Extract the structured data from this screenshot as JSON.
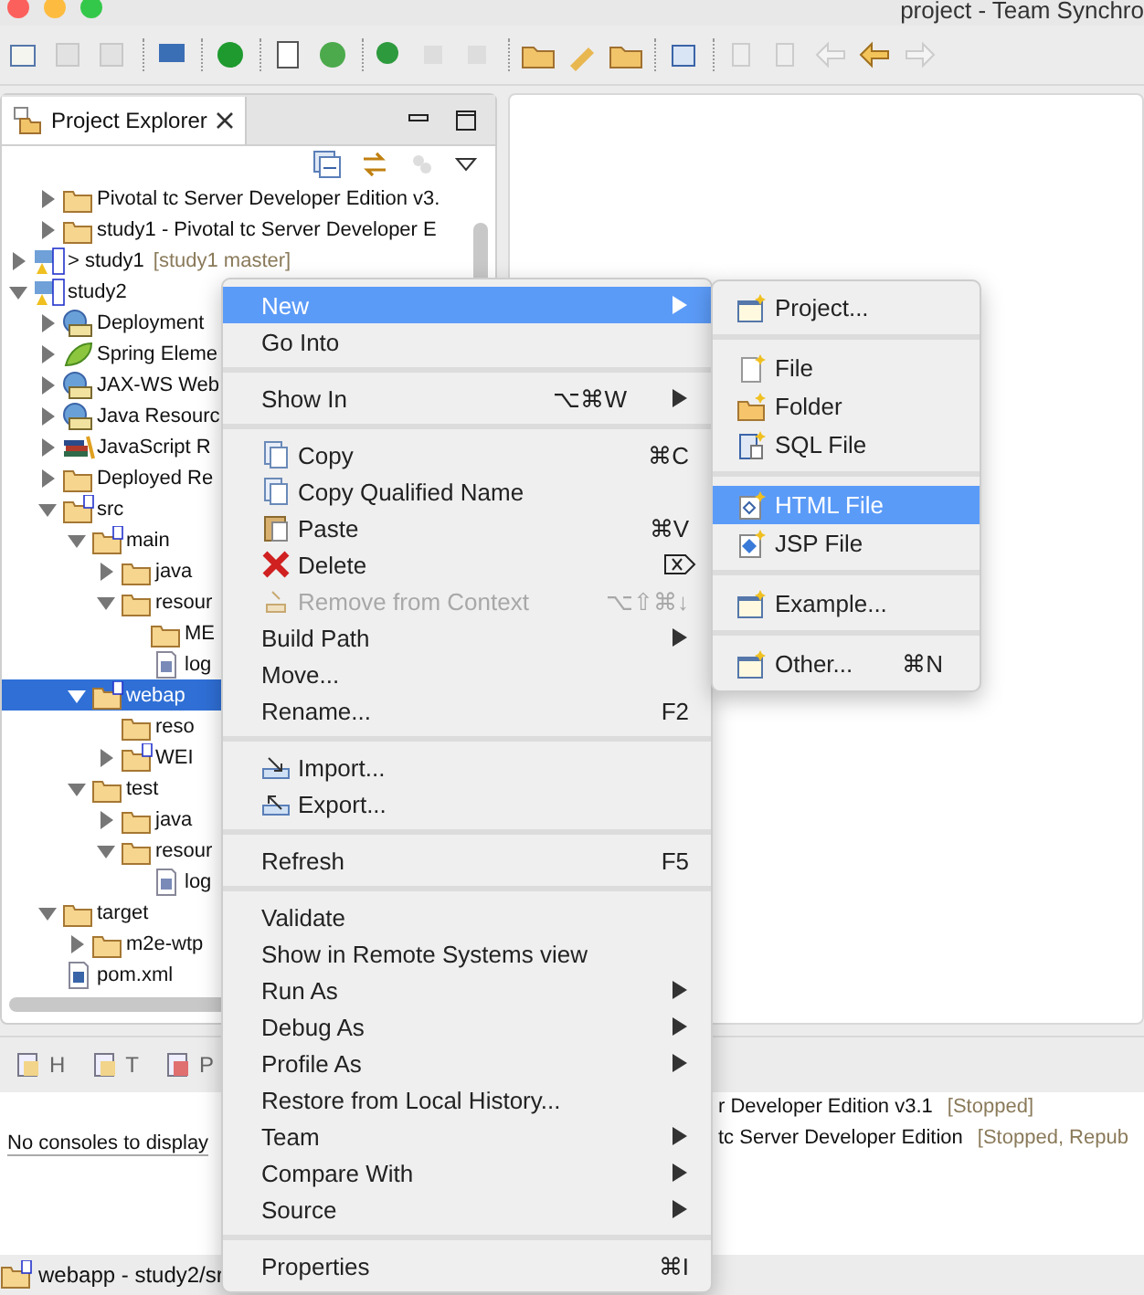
{
  "window": {
    "title": "project - Team Synchro"
  },
  "project_explorer": {
    "tab": {
      "label": "Project Explorer",
      "selected": true
    },
    "tree": [
      {
        "children": [
          {
            "label": "Pivotal tc Server Developer Edition v3.",
            "kind": "folder",
            "expanded": false,
            "selected": false
          },
          {
            "label": "study1 - Pivotal tc Server Developer E",
            "kind": "folder",
            "expanded": false,
            "selected": false
          }
        ]
      },
      {
        "label": "> study1",
        "decoration": "[study1 master]",
        "kind": "project",
        "expanded": false,
        "selected": false
      },
      {
        "label": "study2",
        "kind": "project",
        "expanded": true,
        "selected": false,
        "children": [
          {
            "label": "Deployment",
            "kind": "node",
            "expanded": false,
            "selected": false
          },
          {
            "label": "Spring Eleme",
            "kind": "leaf",
            "expanded": false,
            "selected": false
          },
          {
            "label": "JAX-WS Web",
            "kind": "node",
            "expanded": false,
            "selected": false
          },
          {
            "label": "Java Resourc",
            "kind": "node",
            "expanded": false,
            "selected": false
          },
          {
            "label": "JavaScript R",
            "kind": "books",
            "expanded": false,
            "selected": false
          },
          {
            "label": "Deployed Re",
            "kind": "folder",
            "expanded": false,
            "selected": false
          },
          {
            "label": "src",
            "kind": "source",
            "expanded": true,
            "selected": false,
            "children": [
              {
                "label": "main",
                "kind": "source",
                "expanded": true,
                "selected": false,
                "children": [
                  {
                    "label": "java",
                    "kind": "folder",
                    "expanded": false,
                    "selected": false
                  },
                  {
                    "label": "resour",
                    "kind": "folder",
                    "expanded": true,
                    "selected": false,
                    "children": [
                      {
                        "label": "ME",
                        "kind": "folder",
                        "selected": false
                      },
                      {
                        "label": "log",
                        "kind": "xml",
                        "selected": false
                      }
                    ]
                  }
                ]
              },
              {
                "label": "webap",
                "kind": "source",
                "expanded": true,
                "selected": true,
                "children": [
                  {
                    "label": "reso",
                    "kind": "folder",
                    "selected": false
                  },
                  {
                    "label": "WEI",
                    "kind": "source",
                    "expanded": false,
                    "selected": false
                  }
                ]
              },
              {
                "label": "test",
                "kind": "folder",
                "expanded": true,
                "selected": false,
                "children": [
                  {
                    "label": "java",
                    "kind": "folder",
                    "expanded": false,
                    "selected": false
                  },
                  {
                    "label": "resour",
                    "kind": "folder",
                    "expanded": true,
                    "selected": false,
                    "children": [
                      {
                        "label": "log",
                        "kind": "xml",
                        "selected": false
                      }
                    ]
                  }
                ]
              }
            ]
          },
          {
            "label": "target",
            "kind": "folder",
            "expanded": true,
            "selected": false,
            "children": [
              {
                "label": "m2e-wtp",
                "kind": "folder",
                "expanded": false,
                "selected": false
              }
            ]
          },
          {
            "label": "pom.xml",
            "kind": "pom",
            "selected": false
          }
        ]
      }
    ]
  },
  "bottom_panel": {
    "tabs": [
      {
        "label": "H",
        "selected": false
      },
      {
        "label": "T",
        "selected": false
      },
      {
        "label": "P",
        "selected": false
      }
    ],
    "console_message": "No consoles to display",
    "servers": [
      {
        "name": "r Developer Edition v3.1",
        "status": "[Stopped]"
      },
      {
        "name": "tc Server Developer Edition",
        "status": "[Stopped, Repub"
      }
    ]
  },
  "status_bar": {
    "text": "webapp - study2/sr"
  },
  "context_menu": {
    "items": [
      {
        "kind": "item",
        "label": "New",
        "submenu": true,
        "selected": true
      },
      {
        "kind": "item",
        "label": "Go Into",
        "selected": false
      },
      {
        "kind": "separator"
      },
      {
        "kind": "item",
        "label": "Show In",
        "shortcut": "⌥⌘W",
        "submenu": true,
        "selected": false
      },
      {
        "kind": "separator"
      },
      {
        "kind": "icon-item",
        "label": "Copy",
        "shortcut": "⌘C",
        "selected": false
      },
      {
        "kind": "icon-item",
        "label": "Copy Qualified Name",
        "selected": false
      },
      {
        "kind": "icon-item",
        "label": "Paste",
        "shortcut": "⌘V",
        "selected": false
      },
      {
        "kind": "icon-item",
        "label": "Delete",
        "selected": false
      },
      {
        "kind": "icon-item",
        "label": "Remove from Context",
        "shortcut": "⌥⇧⌘↓",
        "disabled": true,
        "selected": false
      },
      {
        "kind": "item",
        "label": "Build Path",
        "submenu": true,
        "selected": false
      },
      {
        "kind": "item",
        "label": "Move...",
        "selected": false
      },
      {
        "kind": "item",
        "label": "Rename...",
        "shortcut": "F2",
        "selected": false
      },
      {
        "kind": "separator"
      },
      {
        "kind": "icon-item",
        "label": "Import...",
        "selected": false
      },
      {
        "kind": "icon-item",
        "label": "Export...",
        "selected": false
      },
      {
        "kind": "separator"
      },
      {
        "kind": "item",
        "label": "Refresh",
        "shortcut": "F5",
        "selected": false
      },
      {
        "kind": "separator"
      },
      {
        "kind": "item",
        "label": "Validate",
        "selected": false
      },
      {
        "kind": "item",
        "label": "Show in Remote Systems view",
        "selected": false
      },
      {
        "kind": "item",
        "label": "Run As",
        "submenu": true,
        "selected": false
      },
      {
        "kind": "item",
        "label": "Debug As",
        "submenu": true,
        "selected": false
      },
      {
        "kind": "item",
        "label": "Profile As",
        "submenu": true,
        "selected": false
      },
      {
        "kind": "item",
        "label": "Restore from Local History...",
        "selected": false
      },
      {
        "kind": "item",
        "label": "Team",
        "submenu": true,
        "selected": false
      },
      {
        "kind": "item",
        "label": "Compare With",
        "submenu": true,
        "selected": false
      },
      {
        "kind": "item",
        "label": "Source",
        "submenu": true,
        "selected": false
      },
      {
        "kind": "separator"
      },
      {
        "kind": "item",
        "label": "Properties",
        "shortcut": "⌘I",
        "selected": false
      }
    ]
  },
  "submenu": {
    "items": [
      {
        "kind": "item",
        "label": "Project...",
        "selected": false
      },
      {
        "kind": "separator"
      },
      {
        "kind": "item",
        "label": "File",
        "selected": false
      },
      {
        "kind": "item",
        "label": "Folder",
        "selected": false
      },
      {
        "kind": "item",
        "label": "SQL File",
        "selected": false
      },
      {
        "kind": "separator"
      },
      {
        "kind": "item",
        "label": "HTML File",
        "selected": true
      },
      {
        "kind": "item",
        "label": "JSP File",
        "selected": false
      },
      {
        "kind": "separator"
      },
      {
        "kind": "item",
        "label": "Example...",
        "selected": false
      },
      {
        "kind": "separator"
      },
      {
        "kind": "item",
        "label": "Other...",
        "shortcut": "⌘N",
        "selected": false
      }
    ]
  }
}
